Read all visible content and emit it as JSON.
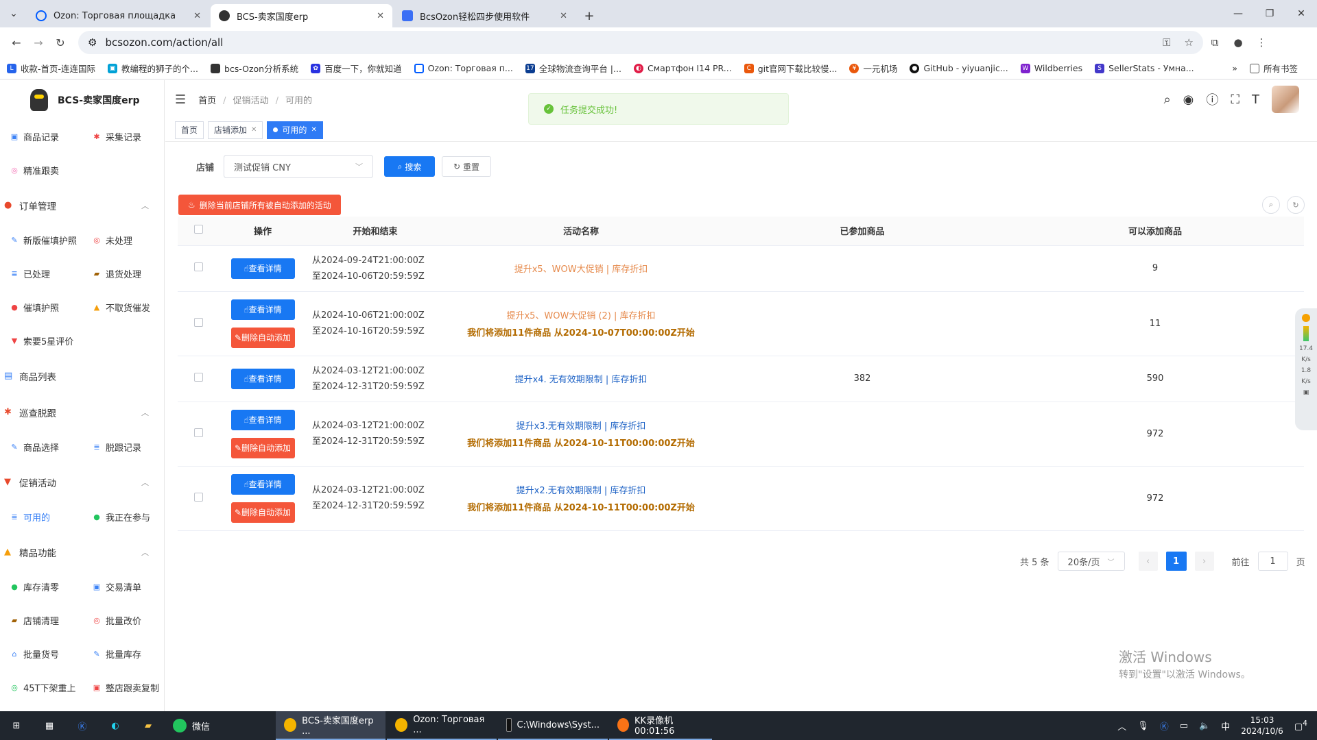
{
  "browser": {
    "tabs": [
      {
        "title": "Ozon: Торговая площадка",
        "active": false
      },
      {
        "title": "BCS-卖家国度erp",
        "active": true
      },
      {
        "title": "BcsOzon轻松四步使用软件",
        "active": false
      }
    ],
    "url": "bcsozon.com/action/all",
    "bookmarks": [
      "收款-首页-连连国际",
      "教编程的狮子的个...",
      "bcs-Ozon分析系统",
      "百度一下，你就知道",
      "Ozon: Торговая п...",
      "全球物流查询平台 |...",
      "Смартфон I14 PR...",
      "git官网下载比较慢...",
      "一元机场",
      "GitHub - yiyuanjic...",
      "Wildberries",
      "SellerStats - Умна..."
    ],
    "all_bookmarks": "所有书签"
  },
  "app": {
    "logo": "BCS-卖家国度erp",
    "breadcrumb": [
      "首页",
      "促销活动",
      "可用的"
    ],
    "toast": "任务提交成功!",
    "tags": [
      {
        "label": "首页",
        "closable": false,
        "active": false
      },
      {
        "label": "店铺添加",
        "closable": true,
        "active": false
      },
      {
        "label": "可用的",
        "closable": true,
        "active": true
      }
    ]
  },
  "sidebar": {
    "top_items": [
      {
        "label": "商品记录",
        "color": "#3b82f6"
      },
      {
        "label": "采集记录",
        "color": "#ef4444"
      },
      {
        "label": "精准跟卖",
        "color": "#f472b6"
      }
    ],
    "groups": [
      {
        "label": "订单管理",
        "items": [
          {
            "label": "新版催填护照",
            "color": "#3b82f6"
          },
          {
            "label": "未处理",
            "color": "#ef4444"
          },
          {
            "label": "已处理",
            "color": "#3b82f6"
          },
          {
            "label": "退货处理",
            "color": "#a16207"
          },
          {
            "label": "催填护照",
            "color": "#ef4444"
          },
          {
            "label": "不取货催发",
            "color": "#f59e0b"
          },
          {
            "label": "索要5星评价",
            "color": "#ef4444"
          }
        ]
      },
      {
        "label": "商品列表",
        "items": []
      },
      {
        "label": "巡查脱跟",
        "items": [
          {
            "label": "商品选择",
            "color": "#3b82f6"
          },
          {
            "label": "脱跟记录",
            "color": "#3b82f6"
          }
        ]
      },
      {
        "label": "促销活动",
        "items": [
          {
            "label": "可用的",
            "color": "#3b82f6",
            "active": true
          },
          {
            "label": "我正在参与",
            "color": "#22c55e"
          }
        ]
      },
      {
        "label": "精品功能",
        "items": [
          {
            "label": "库存清零",
            "color": "#22c55e"
          },
          {
            "label": "交易清单",
            "color": "#3b82f6"
          },
          {
            "label": "店铺清理",
            "color": "#a16207"
          },
          {
            "label": "批量改价",
            "color": "#ef4444"
          },
          {
            "label": "批量货号",
            "color": "#3b82f6"
          },
          {
            "label": "批量库存",
            "color": "#3b82f6"
          },
          {
            "label": "45T下架重上",
            "color": "#22c55e"
          },
          {
            "label": "整店跟卖复制",
            "color": "#ef4444"
          }
        ]
      }
    ]
  },
  "filter": {
    "shop_label": "店铺",
    "shop_value": "测试促销 CNY",
    "search_label": "搜索",
    "reset_label": "重置",
    "delete_all_label": "删除当前店铺所有被自动添加的活动"
  },
  "table": {
    "headers": [
      "操作",
      "开始和结束",
      "活动名称",
      "已参加商品",
      "可以添加商品"
    ],
    "view_label": "查看详情",
    "del_label": "删除自动添加",
    "rows": [
      {
        "start": "从2024-09-24T21:00:00Z",
        "end": "至2024-10-06T20:59:59Z",
        "name": "提升x5、WOW大促销 | 库存折扣",
        "name_color": "#e68a4c",
        "note": "",
        "joined": "",
        "addable": "9",
        "has_delete": false
      },
      {
        "start": "从2024-10-06T21:00:00Z",
        "end": "至2024-10-16T20:59:59Z",
        "name": "提升x5、WOW大促销 (2) | 库存折扣",
        "name_color": "#e68a4c",
        "note": "我们将添加11件商品 从2024-10-07T00:00:00Z开始",
        "joined": "",
        "addable": "11",
        "has_delete": true
      },
      {
        "start": "从2024-03-12T21:00:00Z",
        "end": "至2024-12-31T20:59:59Z",
        "name": "提升x4. 无有效期限制 | 库存折扣",
        "name_color": "#1f63c6",
        "note": "",
        "joined": "382",
        "addable": "590",
        "has_delete": false
      },
      {
        "start": "从2024-03-12T21:00:00Z",
        "end": "至2024-12-31T20:59:59Z",
        "name": "提升x3.无有效期限制 | 库存折扣",
        "name_color": "#1f63c6",
        "note": "我们将添加11件商品 从2024-10-11T00:00:00Z开始",
        "joined": "",
        "addable": "972",
        "has_delete": true
      },
      {
        "start": "从2024-03-12T21:00:00Z",
        "end": "至2024-12-31T20:59:59Z",
        "name": "提升x2.无有效期限制 | 库存折扣",
        "name_color": "#1f63c6",
        "note": "我们将添加11件商品 从2024-10-11T00:00:00Z开始",
        "joined": "",
        "addable": "972",
        "has_delete": true
      }
    ]
  },
  "pagination": {
    "total": "共 5 条",
    "page_size": "20条/页",
    "current": "1",
    "goto_label": "前往",
    "goto_value": "1",
    "page_suffix": "页"
  },
  "watermark": {
    "line1": "激活 Windows",
    "line2": "转到\"设置\"以激活 Windows。"
  },
  "floatbar": {
    "v1": "17.4",
    "u1": "K/s",
    "v2": "1.8",
    "u2": "K/s"
  },
  "taskbar": {
    "apps": [
      {
        "label": "微信",
        "color": "#22c55e"
      },
      {
        "label": "BCS-卖家国度erp ...",
        "color": "#f4b400",
        "active": true
      },
      {
        "label": "Ozon: Торговая ...",
        "color": "#f4b400"
      },
      {
        "label": "C:\\Windows\\Syst...",
        "color": "#111"
      },
      {
        "label": "KK录像机 00:01:56",
        "color": "#f97316"
      }
    ],
    "ime": "中",
    "time": "15:03",
    "date": "2024/10/6",
    "notif": "4"
  }
}
